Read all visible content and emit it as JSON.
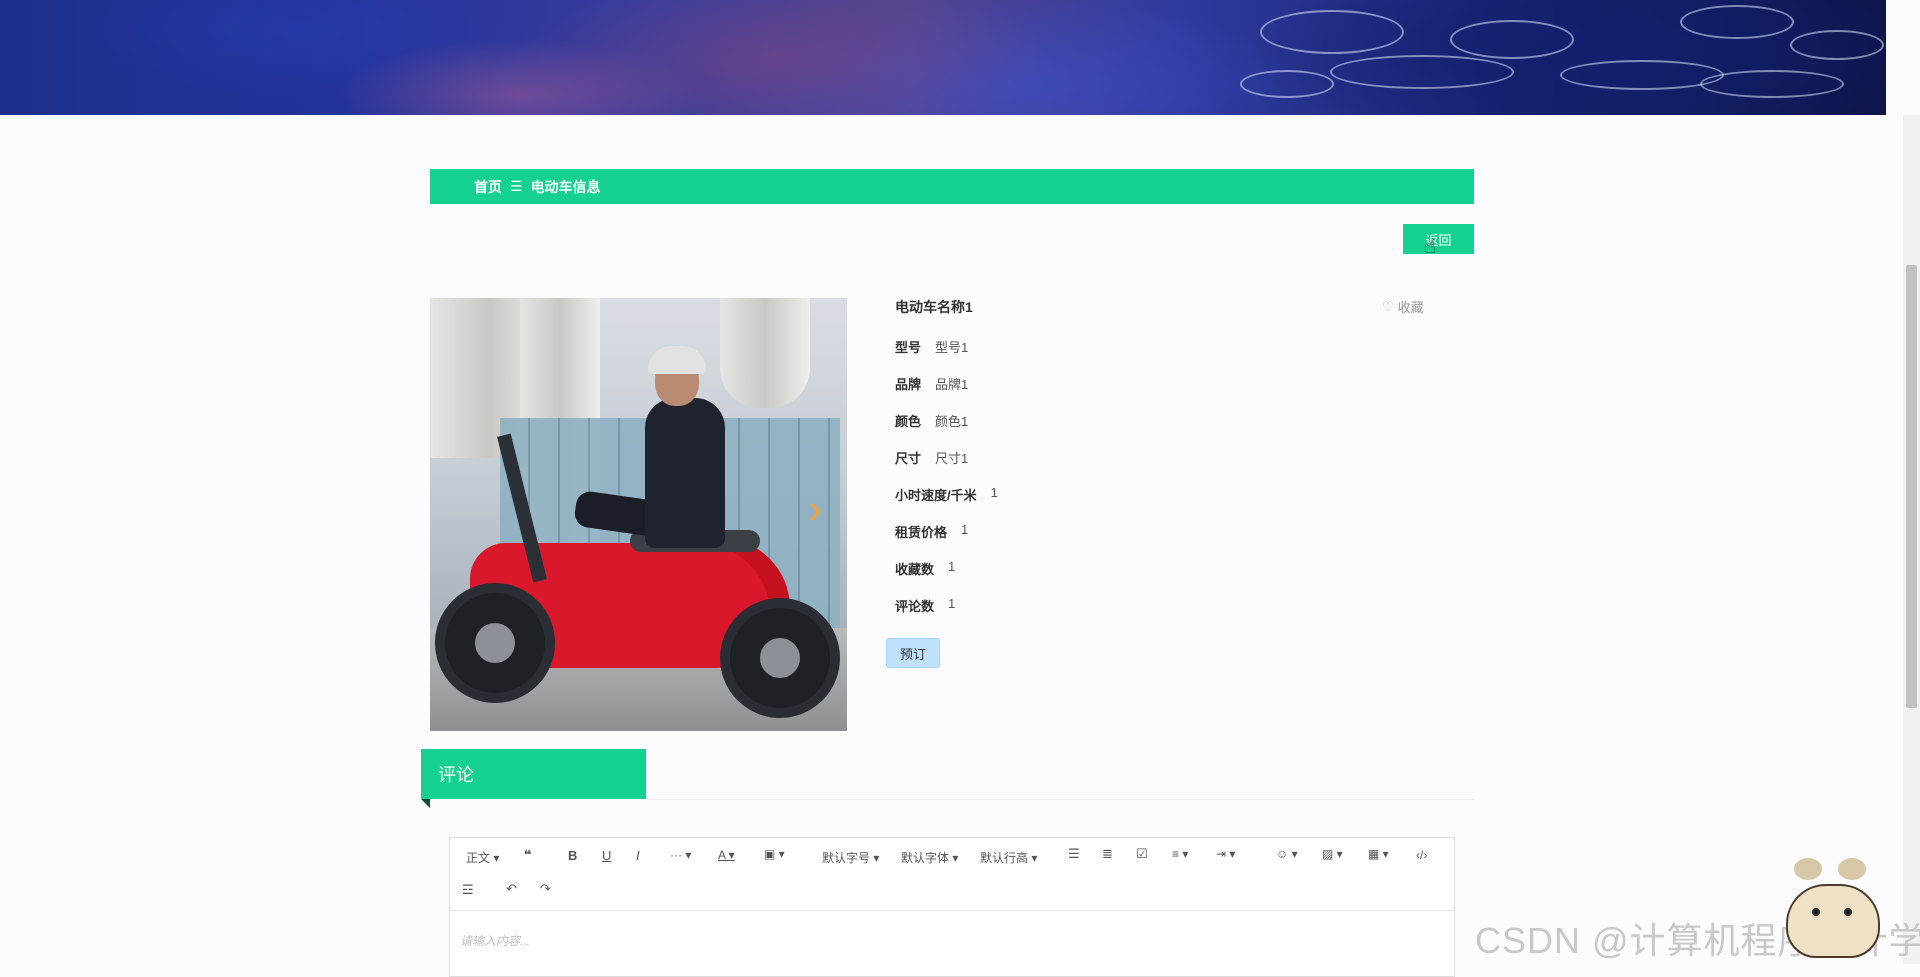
{
  "breadcrumb": {
    "home": "首页",
    "separator": "☰",
    "current": "电动车信息"
  },
  "back_button": "返回",
  "product": {
    "name": "电动车名称1",
    "collect_label": "收藏",
    "attributes": [
      {
        "label": "型号",
        "value": "型号1"
      },
      {
        "label": "品牌",
        "value": "品牌1"
      },
      {
        "label": "颜色",
        "value": "颜色1"
      },
      {
        "label": "尺寸",
        "value": "尺寸1"
      },
      {
        "label": "小时速度/千米",
        "value": "1"
      },
      {
        "label": "租赁价格",
        "value": "1"
      },
      {
        "label": "收藏数",
        "value": "1"
      },
      {
        "label": "评论数",
        "value": "1"
      }
    ],
    "reserve_label": "预订"
  },
  "comment": {
    "title": "评论",
    "toolbar": {
      "paragraph": "正文",
      "font_size": "默认字号",
      "font_family": "默认字体",
      "line_height": "默认行高"
    },
    "placeholder": "请输入内容..."
  },
  "watermark": "CSDN @计算机程序设计学长",
  "colors": {
    "accent": "#14d191",
    "reserve_bg": "#bfe1fb",
    "arrow": "#f3a03a"
  }
}
